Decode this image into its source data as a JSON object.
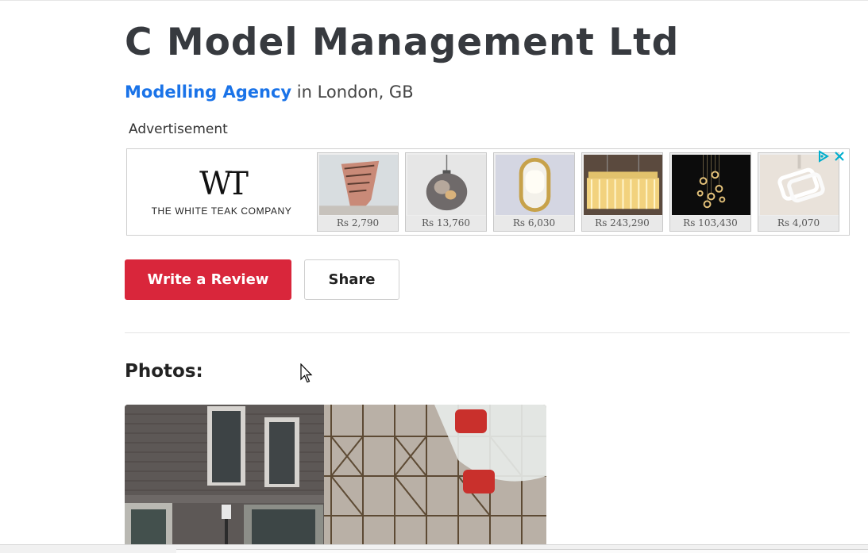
{
  "business": {
    "name": "C Model Management Ltd",
    "category_link": "Modelling Agency",
    "location_text": " in London, GB"
  },
  "ad": {
    "label": "Advertisement",
    "brand_logo": "WT",
    "brand_name": "THE WHITE TEAK COMPANY",
    "adchoices_icon": "adchoices-icon",
    "close_icon": "close-icon",
    "products": [
      {
        "price": "Rs 2,790",
        "image": "decor-plaque"
      },
      {
        "price": "Rs 13,760",
        "image": "glass-pendant-lamp"
      },
      {
        "price": "Rs 6,030",
        "image": "oval-wall-light"
      },
      {
        "price": "Rs 243,290",
        "image": "crystal-chandelier"
      },
      {
        "price": "Rs 103,430",
        "image": "ring-pendant-lights"
      },
      {
        "price": "Rs 4,070",
        "image": "square-ceiling-light"
      }
    ]
  },
  "actions": {
    "write_review": "Write a Review",
    "share": "Share"
  },
  "photos": {
    "heading": "Photos:"
  },
  "colors": {
    "accent_red": "#d9263b",
    "link_blue": "#1a73e8",
    "title": "#373a3f"
  }
}
